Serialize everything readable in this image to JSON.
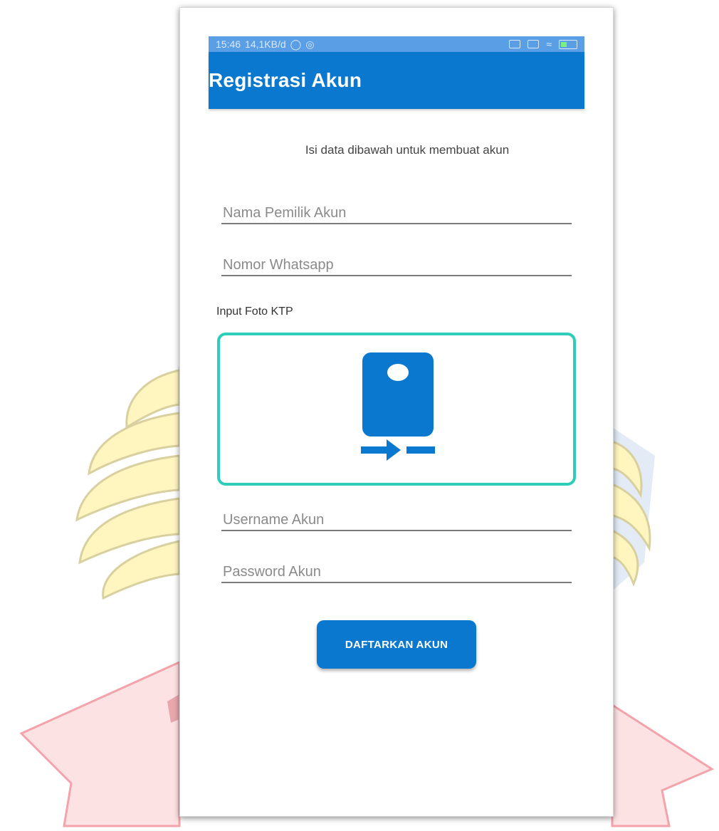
{
  "status_bar": {
    "time": "15:46",
    "speed": "14,1KB/d",
    "icons": [
      "sync-icon",
      "location-icon",
      "signal-icon",
      "signal-icon",
      "wifi-icon",
      "battery-icon"
    ]
  },
  "app_bar": {
    "title": "Registrasi Akun"
  },
  "form": {
    "subtitle": "Isi data dibawah untuk membuat akun",
    "name_placeholder": "Nama Pemilik Akun",
    "whatsapp_placeholder": "Nomor Whatsapp",
    "photo_label": "Input Foto KTP",
    "photo_icon": "camera-switch-icon",
    "username_placeholder": "Username Akun",
    "password_placeholder": "Password Akun",
    "submit_label": "DAFTARKAN AKUN"
  },
  "colors": {
    "primary": "#0a78cf",
    "accent_border": "#2ecdb9",
    "watermark_yellow": "#fff4b0",
    "watermark_pink": "#f7a6ae",
    "watermark_blue": "#c8d8ec"
  }
}
